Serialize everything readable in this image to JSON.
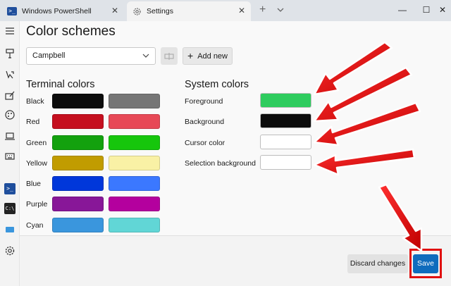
{
  "titlebar": {
    "tabs": [
      {
        "label": "Windows PowerShell"
      },
      {
        "label": "Settings"
      }
    ],
    "new_tab_glyph": "+",
    "close_glyph": "✕",
    "minimize_glyph": "—",
    "maximize_glyph": "☐",
    "window_close_glyph": "✕"
  },
  "page": {
    "title": "Color schemes"
  },
  "scheme": {
    "selected": "Campbell",
    "add_label": "Add new"
  },
  "terminal_colors": {
    "title": "Terminal colors",
    "rows": [
      {
        "label": "Black",
        "normal": "#0c0c0c",
        "bright": "#767676"
      },
      {
        "label": "Red",
        "normal": "#c50f1f",
        "bright": "#e74856"
      },
      {
        "label": "Green",
        "normal": "#13a10e",
        "bright": "#16c60c"
      },
      {
        "label": "Yellow",
        "normal": "#c19c00",
        "bright": "#f9f1a5"
      },
      {
        "label": "Blue",
        "normal": "#0037da",
        "bright": "#3b78ff"
      },
      {
        "label": "Purple",
        "normal": "#881798",
        "bright": "#b4009e"
      },
      {
        "label": "Cyan",
        "normal": "#3a96dd",
        "bright": "#61d6d6"
      }
    ]
  },
  "system_colors": {
    "title": "System colors",
    "rows": [
      {
        "label": "Foreground",
        "color": "#2ecc5e"
      },
      {
        "label": "Background",
        "color": "#0c0c0c"
      },
      {
        "label": "Cursor color",
        "color": "#ffffff"
      },
      {
        "label": "Selection background",
        "color": "#ffffff"
      }
    ]
  },
  "footer": {
    "discard_label": "Discard changes",
    "save_label": "Save"
  },
  "colors": {
    "accent": "#0f6cbd",
    "annotation_red": "#e01010"
  },
  "sidebar": {
    "icons": [
      "menu-icon",
      "startup-icon",
      "interaction-icon",
      "appearance-icon",
      "color-schemes-icon",
      "rendering-icon",
      "actions-icon",
      "powershell-profile-icon",
      "cmd-profile-icon",
      "azure-profile-icon",
      "settings-icon"
    ]
  }
}
